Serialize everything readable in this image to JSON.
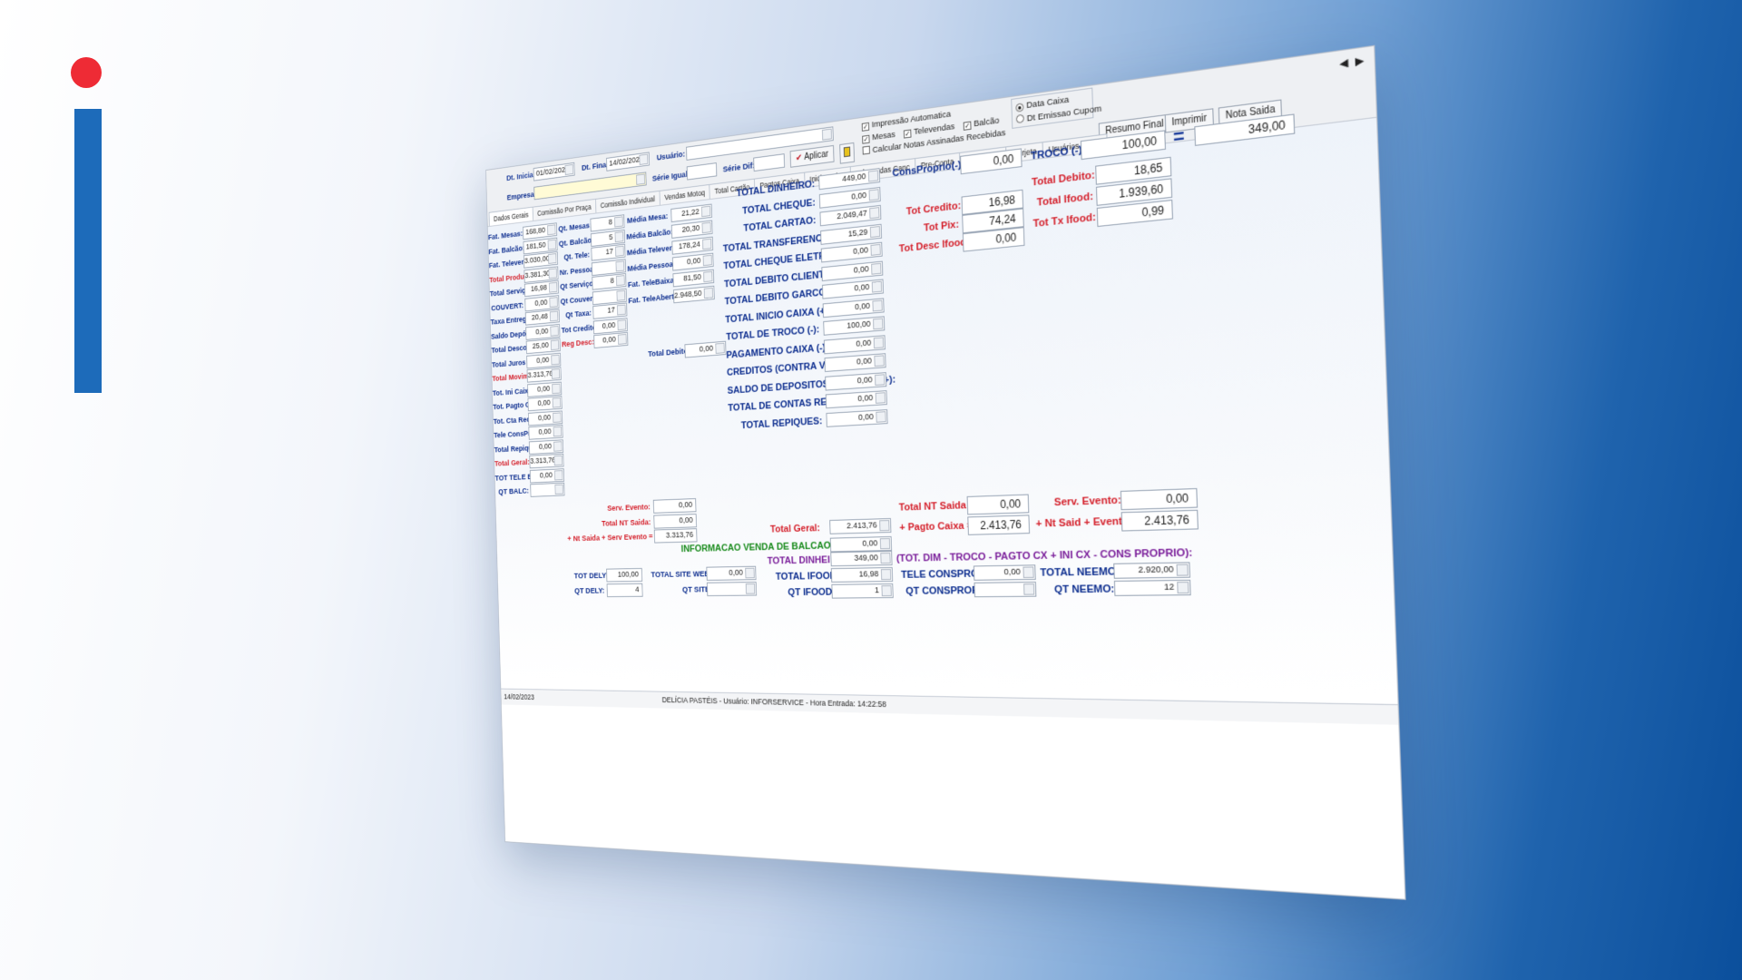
{
  "brand": {
    "dot_color": "#ee2b35",
    "bar_color": "#1d6bba"
  },
  "header": {
    "dt_inicial_label": "Dt. Inicial:",
    "dt_inicial": "01/02/2023",
    "dt_final_label": "Dt. Final:",
    "dt_final": "14/02/2023",
    "usuario_label": "Usuário:",
    "usuario": "",
    "empresa_label": "Empresa:",
    "empresa": "",
    "serie_igual_label": "Série Igual:",
    "serie_dif_label": "Série Dif:",
    "aplicar": "Aplicar",
    "chk_impressao": "Impressão Automatica",
    "chk_mesas": "Mesas",
    "chk_televendas": "Televendas",
    "chk_balcao": "Balcão",
    "chk_calcular": "Calcular Notas Assinadas Recebidas",
    "radio_data_caixa": "Data Caixa",
    "radio_dt_emissao": "Dt Emissao Cupom",
    "btn_resumo": "Resumo Final",
    "btn_imprimir": "Imprimir",
    "btn_nota": "Nota Saida"
  },
  "tabs_left": [
    "Dados Gerais",
    "Comissão Por Praça",
    "Comissão Individual",
    "Vendas Motoq",
    "Total Cartão",
    "Pagtos Caixa",
    "Inicio Caixa",
    "Televendas Canc",
    "Pre-Conta",
    "Descontos",
    "Gorjeta",
    "Usuários Caixa"
  ],
  "col1": [
    {
      "label": "Fat. Mesas:",
      "value": "168,80"
    },
    {
      "label": "Fat. Balcão:",
      "value": "181,50"
    },
    {
      "label": "Fat. Televenda:",
      "value": "3.030,00"
    },
    {
      "label": "Total Produtos:",
      "value": "3.381,30",
      "red": true
    },
    {
      "label": "Total Serviços:",
      "value": "16,98"
    },
    {
      "label": "COUVERT:",
      "value": "0,00"
    },
    {
      "label": "Taxa Entrega:",
      "value": "20,48"
    },
    {
      "label": "Saldo Depósito:",
      "value": "0,00"
    },
    {
      "label": "Total Descontos:",
      "value": "25,00"
    },
    {
      "label": "Total Juros Cli:",
      "value": "0,00"
    },
    {
      "label": "Total Movimento:",
      "value": "3.313,76",
      "red": true
    },
    {
      "label": "Tot. Ini Caixa:",
      "value": "0,00"
    },
    {
      "label": "Tot. Pagto Caixa:",
      "value": "0,00"
    },
    {
      "label": "Tot. Cta Recebida:",
      "value": "0,00"
    },
    {
      "label": "Tele ConsProprio:",
      "value": "0,00"
    },
    {
      "label": "Total Repiques:",
      "value": "0,00"
    },
    {
      "label": "Total Geral:",
      "value": "3.313,76",
      "red": true
    },
    {
      "label": "TOT TELE BALC:",
      "value": "0,00"
    },
    {
      "label": "QT BALC:",
      "value": ""
    }
  ],
  "col2": [
    {
      "label": "Qt. Mesas:",
      "value": "8"
    },
    {
      "label": "Qt. Balcão:",
      "value": "5"
    },
    {
      "label": "Qt. Tele:",
      "value": "17"
    },
    {
      "label": "Nr. Pessoas:",
      "value": ""
    },
    {
      "label": "Qt Serviço:",
      "value": "8"
    },
    {
      "label": "Qt Couvert:",
      "value": ""
    },
    {
      "label": "Qt Taxa:",
      "value": "17"
    },
    {
      "label": "Tot Credito:",
      "value": "0,00"
    },
    {
      "label": "Reg Desc:",
      "value": "0,00",
      "red": true
    }
  ],
  "col2b": [
    {
      "label": "Serv. Evento:",
      "value": "0,00"
    },
    {
      "label": "Total NT Saida:",
      "value": "0,00"
    },
    {
      "label": "+ Nt Saida + Serv Evento =",
      "value": "3.313,76"
    }
  ],
  "col3": [
    {
      "label": "Média Mesa:",
      "value": "21,22"
    },
    {
      "label": "Média Balcão:",
      "value": "20,30"
    },
    {
      "label": "Média Televenda:",
      "value": "178,24"
    },
    {
      "label": "Média Pessoa:",
      "value": "0,00"
    },
    {
      "label": "Fat. TeleBaixada:",
      "value": "81,50"
    },
    {
      "label": "Fat. TeleAbertas:",
      "value": "2.948,50"
    }
  ],
  "total_debito_small": {
    "label": "Total Debito:",
    "value": "0,00"
  },
  "dely": {
    "tot_label": "TOT DELY:",
    "tot": "100,00",
    "qt_label": "QT DELY:",
    "qt": "4"
  },
  "site": {
    "tot_label": "TOTAL SITE WEB:",
    "tot": "0,00",
    "qt_label": "QT SITE:",
    "qt": ""
  },
  "col4": [
    {
      "label": "TOTAL DINHEIRO:",
      "value": "449,00"
    },
    {
      "label": "TOTAL CHEQUE:",
      "value": "0,00"
    },
    {
      "label": "TOTAL CARTAO:",
      "value": "2.049,47"
    },
    {
      "label": "TOTAL TRANSFERENCIA:",
      "value": "15,29"
    },
    {
      "label": "TOTAL CHEQUE ELETRO:",
      "value": "0,00"
    },
    {
      "label": "TOTAL DEBITO CLIENTE:",
      "value": "0,00"
    },
    {
      "label": "TOTAL DEBITO GARCON:",
      "value": "0,00"
    },
    {
      "label": "TOTAL INICIO CAIXA (+):",
      "value": "0,00"
    },
    {
      "label": "TOTAL DE TROCO (-):",
      "value": "100,00"
    },
    {
      "label": "PAGAMENTO CAIXA (-):",
      "value": "0,00"
    },
    {
      "label": "CREDITOS (CONTRA VALE) (+):",
      "value": "0,00"
    },
    {
      "label": "SALDO DE DEPOSITOS CLIENTES (+):",
      "value": "0,00"
    },
    {
      "label": "TOTAL DE CONTAS RECEBIDAS (+):",
      "value": "0,00"
    },
    {
      "label": "TOTAL REPIQUES:",
      "value": "0,00"
    }
  ],
  "total_geral": {
    "label": "Total Geral:",
    "value": "2.413,76"
  },
  "info_balcao": {
    "label": "INFORMACAO VENDA DE BALCAO MESA:",
    "value": "0,00"
  },
  "total_dinheiro2": {
    "label": "TOTAL DINHEIRO:",
    "value": "349,00",
    "formula": "(TOT. DIM - TROCO - PAGTO CX + INI CX - CONS PROPRIO):"
  },
  "ifood": {
    "tot_label": "TOTAL IFOOD:",
    "tot": "16,98",
    "qt_label": "QT IFOOD:",
    "qt": "1"
  },
  "consprop": {
    "tele_label": "TELE CONSPROP:",
    "tele": "0,00",
    "qt_label": "QT CONSPROP:",
    "qt": ""
  },
  "neemo": {
    "tot_label": "TOTAL NEEMO:",
    "tot": "2.920,00",
    "qt_label": "QT NEEMO:",
    "qt": "12"
  },
  "right": {
    "consproprio_label": "ConsProprio(-):",
    "consproprio": "0,00",
    "troco_label": "TROCO (-):",
    "troco": "100,00",
    "result": "349,00",
    "tot_credito_label": "Tot Credito:",
    "tot_credito": "16,98",
    "tot_pix_label": "Tot Pix:",
    "tot_pix": "74,24",
    "tot_desc_ifood_label": "Tot Desc Ifood:",
    "tot_desc_ifood": "0,00",
    "total_debito_label": "Total Debito:",
    "total_debito": "18,65",
    "total_ifood_label": "Total Ifood:",
    "total_ifood": "1.939,60",
    "tot_tx_ifood_label": "Tot Tx Ifood:",
    "tot_tx_ifood": "0,99",
    "total_nt_saida_label": "Total NT Saida:",
    "total_nt_saida": "0,00",
    "serv_evento_label": "Serv. Evento:",
    "serv_evento": "0,00",
    "pagto_caixa_label": "+ Pagto Caixa =",
    "pagto_caixa": "2.413,76",
    "nt_said_evento_label": "+ Nt Said + Evento =",
    "nt_said_evento": "2.413,76"
  },
  "status": {
    "date": "14/02/2023",
    "text": "DELÍCIA PASTÉIS - Usuário: INFORSERVICE - Hora Entrada: 14:22:58"
  }
}
